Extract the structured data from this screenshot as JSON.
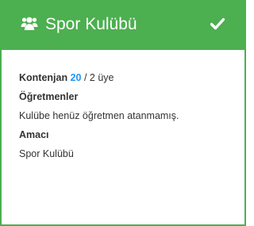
{
  "header": {
    "title": "Spor Kulübü",
    "group_icon": "users-icon",
    "status_icon": "check-icon"
  },
  "body": {
    "quota_label": "Kontenjan",
    "quota_count": "20",
    "quota_rest": "/ 2 üye",
    "teachers_heading": "Öğretmenler",
    "teachers_text": "Kulübe henüz öğretmen atanmamış.",
    "purpose_heading": "Amacı",
    "purpose_text": "Spor Kulübü"
  },
  "colors": {
    "accent": "#4caf50",
    "count": "#2196f3"
  }
}
